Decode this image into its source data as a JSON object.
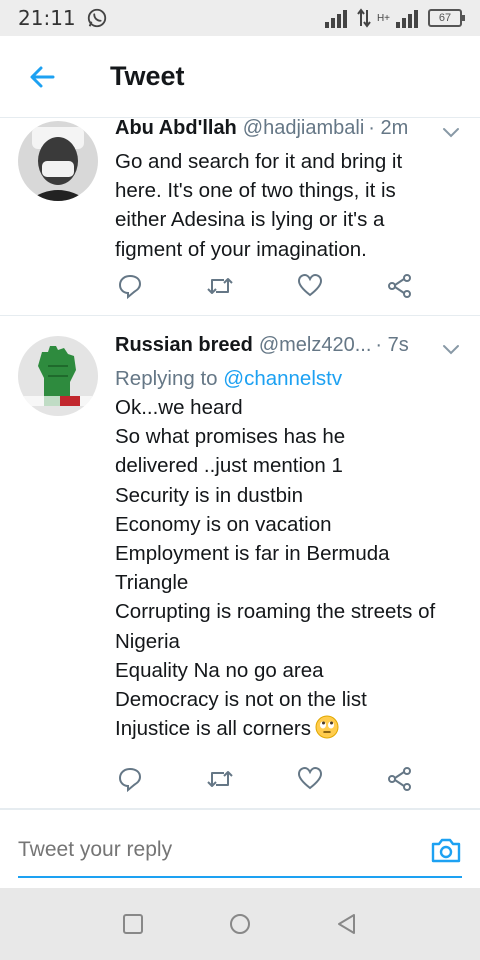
{
  "status_bar": {
    "time": "21:11",
    "battery": "67",
    "network": "H+"
  },
  "header": {
    "title": "Tweet"
  },
  "tweets": [
    {
      "username": "Abu Abd'llah",
      "handle": "@hadjiambali",
      "time": "· 2m",
      "lines": [
        "Go and search for it and bring it",
        "here. It's one of two things, it is",
        "either Adesina is lying or it's a",
        "figment of your imagination."
      ]
    },
    {
      "username": "Russian breed",
      "handle": "@melz420...",
      "time": "· 7s",
      "replying_prefix": "Replying to",
      "replying_to": "@channelstv",
      "lines": [
        "Ok...we heard",
        "So what promises has he",
        "delivered ..just mention 1",
        "Security is in dustbin",
        "Economy is on vacation",
        "Employment is far in Bermuda",
        "Triangle",
        "Corrupting is roaming the streets of",
        "Nigeria",
        "Equality Na no go area",
        "Democracy is not on the list",
        "Injustice is all corners"
      ],
      "emoji": "face-with-rolling-eyes"
    }
  ],
  "reply": {
    "placeholder": "Tweet your reply"
  },
  "colors": {
    "accent": "#1da1f2",
    "secondary_text": "#657786",
    "primary_text": "#14171a",
    "divider": "#e6ecf0"
  }
}
